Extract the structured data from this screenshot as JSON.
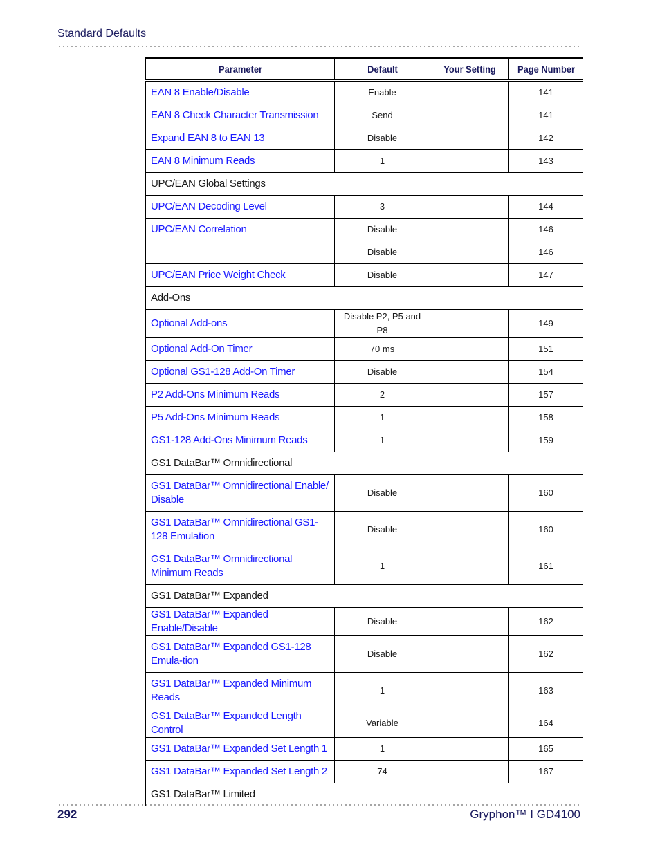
{
  "header": {
    "running_head": "Standard Defaults"
  },
  "table": {
    "columns": [
      "Parameter",
      "Default",
      "Your Setting",
      "Page Number"
    ],
    "rows": [
      {
        "type": "item",
        "parameter": "EAN 8 Enable/Disable",
        "default": "Enable",
        "setting": "",
        "page": "141"
      },
      {
        "type": "item",
        "parameter": "EAN 8 Check Character Transmission",
        "default": "Send",
        "setting": "",
        "page": "141"
      },
      {
        "type": "item",
        "parameter": "Expand EAN 8 to EAN 13",
        "default": "Disable",
        "setting": "",
        "page": "142"
      },
      {
        "type": "item",
        "parameter": "EAN 8 Minimum Reads",
        "default": "1",
        "setting": "",
        "page": "143"
      },
      {
        "type": "section",
        "parameter": "UPC/EAN Global Settings"
      },
      {
        "type": "item",
        "parameter": "UPC/EAN Decoding Level",
        "default": "3",
        "setting": "",
        "page": "144"
      },
      {
        "type": "item",
        "parameter": "UPC/EAN Correlation",
        "default": "Disable",
        "setting": "",
        "page": "146"
      },
      {
        "type": "item",
        "parameter": "",
        "default": "Disable",
        "setting": "",
        "page": "146"
      },
      {
        "type": "item",
        "parameter": "UPC/EAN Price Weight Check",
        "default": "Disable",
        "setting": "",
        "page": "147"
      },
      {
        "type": "section",
        "parameter": "Add-Ons"
      },
      {
        "type": "item",
        "parameter": "Optional Add-ons",
        "default": "Disable P2, P5 and P8",
        "setting": "",
        "page": "149"
      },
      {
        "type": "item",
        "parameter": "Optional Add-On Timer",
        "default": "70 ms",
        "setting": "",
        "page": "151"
      },
      {
        "type": "item",
        "parameter": "Optional GS1-128 Add-On Timer",
        "default": "Disable",
        "setting": "",
        "page": "154"
      },
      {
        "type": "item",
        "parameter": "P2 Add-Ons Minimum Reads",
        "default": "2",
        "setting": "",
        "page": "157"
      },
      {
        "type": "item",
        "parameter": "P5 Add-Ons Minimum Reads",
        "default": "1",
        "setting": "",
        "page": "158"
      },
      {
        "type": "item",
        "parameter": "GS1-128 Add-Ons Minimum Reads",
        "default": "1",
        "setting": "",
        "page": "159"
      },
      {
        "type": "section",
        "parameter": "GS1 DataBar™ Omnidirectional"
      },
      {
        "type": "item",
        "tall": true,
        "parameter": "GS1 DataBar™ Omnidirectional Enable/ Disable",
        "default": "Disable",
        "setting": "",
        "page": "160"
      },
      {
        "type": "item",
        "tall": true,
        "parameter": "GS1 DataBar™ Omnidirectional GS1-128 Emulation",
        "default": "Disable",
        "setting": "",
        "page": "160"
      },
      {
        "type": "item",
        "tall": true,
        "parameter": "GS1 DataBar™ Omnidirectional Minimum Reads",
        "default": "1",
        "setting": "",
        "page": "161"
      },
      {
        "type": "section",
        "parameter": "GS1 DataBar™ Expanded"
      },
      {
        "type": "item",
        "parameter": "GS1 DataBar™ Expanded Enable/Disable",
        "default": "Disable",
        "setting": "",
        "page": "162"
      },
      {
        "type": "item",
        "tall": true,
        "parameter": "GS1 DataBar™ Expanded GS1-128 Emula-tion",
        "default": "Disable",
        "setting": "",
        "page": "162"
      },
      {
        "type": "item",
        "tall": true,
        "parameter": "GS1 DataBar™ Expanded Minimum Reads",
        "default": "1",
        "setting": "",
        "page": "163"
      },
      {
        "type": "item",
        "parameter": "GS1 DataBar™ Expanded Length Control",
        "default": "Variable",
        "setting": "",
        "page": "164"
      },
      {
        "type": "item",
        "parameter": "GS1 DataBar™ Expanded Set Length 1",
        "default": "1",
        "setting": "",
        "page": "165"
      },
      {
        "type": "item",
        "parameter": "GS1 DataBar™ Expanded Set Length 2",
        "default": "74",
        "setting": "",
        "page": "167"
      },
      {
        "type": "section",
        "parameter": "GS1 DataBar™  Limited"
      }
    ]
  },
  "footer": {
    "page_number": "292",
    "product": "Gryphon™ I GD4100"
  },
  "colors": {
    "link": "#1a1aff",
    "heading": "#1a1a5e",
    "text": "#1a1a1a"
  }
}
